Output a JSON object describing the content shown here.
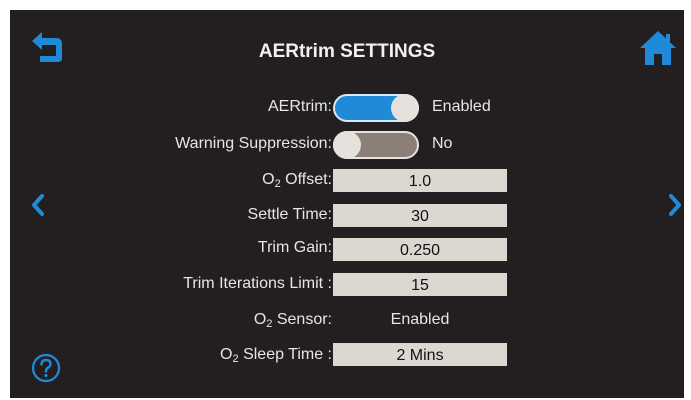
{
  "header": {
    "title": "AERtrim SETTINGS",
    "back_icon": "return-arrow-icon",
    "home_icon": "home-icon"
  },
  "nav": {
    "prev_icon": "chevron-left-icon",
    "next_icon": "chevron-right-icon",
    "help_icon": "help-icon"
  },
  "settings": {
    "aertrim": {
      "label": "AERtrim:",
      "state": "Enabled",
      "on": true
    },
    "warning_suppression": {
      "label": "Warning Suppression:",
      "state": "No",
      "on": false
    },
    "o2_offset": {
      "label_prefix": "O",
      "label_sub": "2",
      "label_suffix": " Offset:",
      "value": "1.0"
    },
    "settle_time": {
      "label": "Settle Time:",
      "value": "30"
    },
    "trim_gain": {
      "label": "Trim Gain:",
      "value": "0.250"
    },
    "trim_iterations_limit": {
      "label": "Trim Iterations Limit :",
      "value": "15"
    },
    "o2_sensor": {
      "label_prefix": "O",
      "label_sub": "2",
      "label_suffix": " Sensor:",
      "value": "Enabled"
    },
    "o2_sleep_time": {
      "label_prefix": "O",
      "label_sub": "2",
      "label_suffix": " Sleep Time :",
      "value": "2 Mins"
    }
  },
  "colors": {
    "background": "#231f20",
    "accent": "#1f8ad8",
    "field": "#ddd7d2"
  }
}
